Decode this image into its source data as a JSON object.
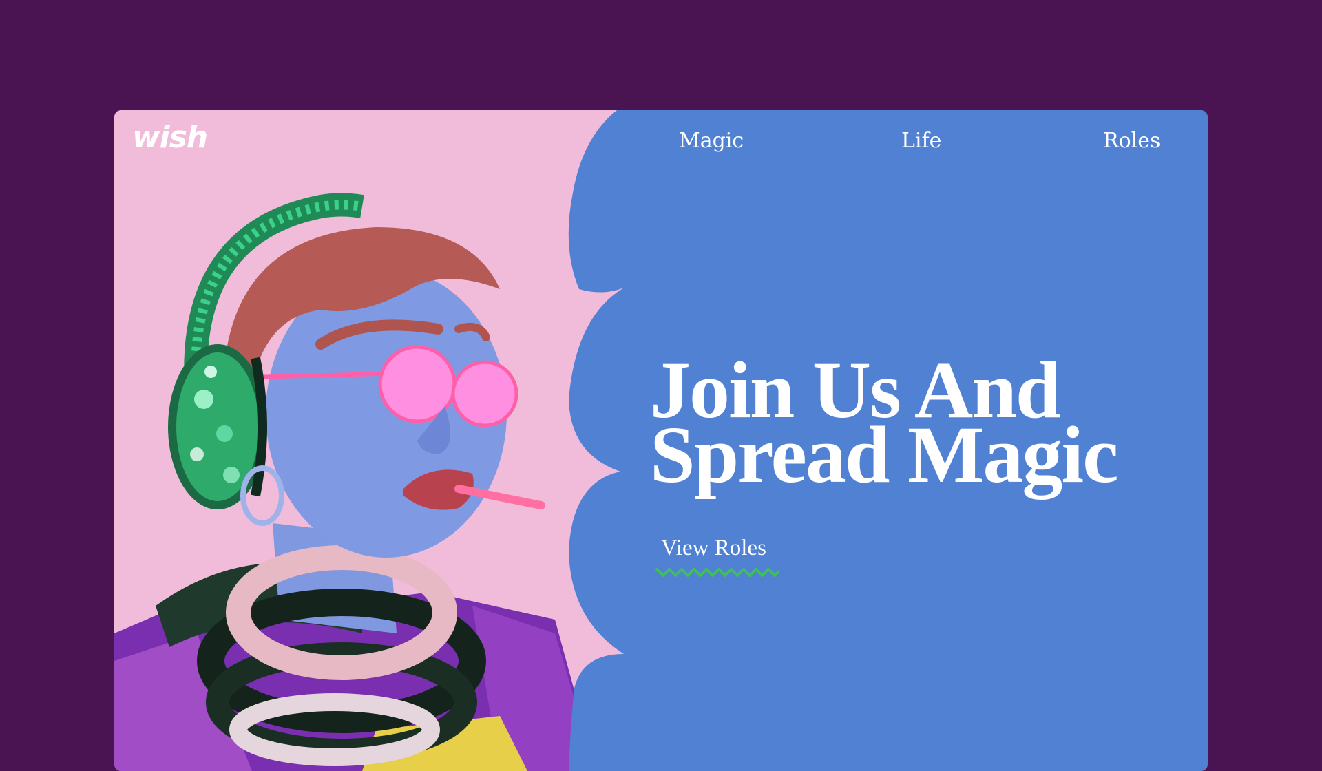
{
  "brand": {
    "logo_text": "wish"
  },
  "nav": {
    "items": [
      {
        "label": "Magic"
      },
      {
        "label": "Life"
      },
      {
        "label": "Roles"
      }
    ]
  },
  "hero": {
    "headline_line1": "Join Us And",
    "headline_line2": "Spread Magic",
    "cta_label": "View Roles"
  },
  "colors": {
    "page_background": "#4a1352",
    "hero_blue": "#5081d2",
    "photo_background": "#f0bcd9",
    "cta_underline": "#3fbf5a",
    "text": "#ffffff"
  }
}
